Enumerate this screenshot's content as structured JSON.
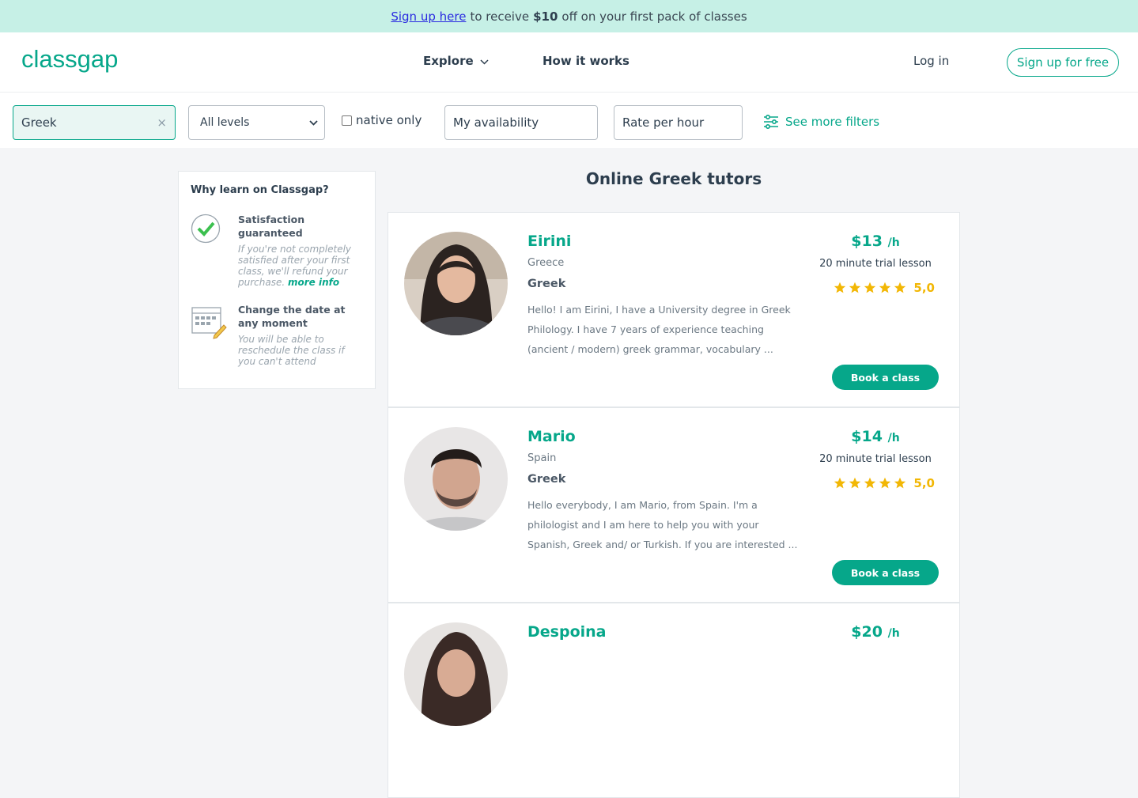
{
  "banner": {
    "link": "Sign up here",
    "text_before": "to receive",
    "amount": "$10",
    "text_after": "off on your first pack of classes"
  },
  "header": {
    "brand": "classgap",
    "nav_explore": "Explore",
    "nav_how": "How it works",
    "login": "Log in",
    "signup": "Sign up for free"
  },
  "filters": {
    "search_value": "Greek",
    "clear": "×",
    "level": "All levels",
    "native_label": "native only",
    "availability": "My availability",
    "rate": "Rate per hour",
    "more": "See more filters"
  },
  "sidebar": {
    "title": "Why learn on Classgap?",
    "items": [
      {
        "title": "Satisfaction guaranteed",
        "desc": "If you're not completely satisfied after your first class, we'll refund your purchase.",
        "link": "more info"
      },
      {
        "title": "Change the date at any moment",
        "desc": "You will be able to reschedule the class if you can't attend"
      }
    ]
  },
  "main": {
    "title": "Online Greek tutors",
    "book_label": "Book a class",
    "per_hour": "/h",
    "tutors": [
      {
        "name": "Eirini",
        "country": "Greece",
        "subject": "Greek",
        "desc": "Hello! I am Eirini, I have a University degree in Greek Philology. I have 7 years of experience teaching (ancient / modern) greek grammar, vocabulary ...",
        "price": "$13",
        "trial": "20 minute trial lesson",
        "rating": "5,0"
      },
      {
        "name": "Mario",
        "country": "Spain",
        "subject": "Greek",
        "desc": "Hello everybody, I am Mario, from Spain. I'm a philologist and I am here to help you with your Spanish, Greek and/ or Turkish. If you are interested ...",
        "price": "$14",
        "trial": "20 minute trial lesson",
        "rating": "5,0"
      },
      {
        "name": "Despoina",
        "country": "",
        "subject": "",
        "desc": "",
        "price": "$20",
        "trial": "",
        "rating": ""
      }
    ]
  },
  "colors": {
    "brand": "#06a78a",
    "banner_bg": "#c6f0e6",
    "star": "#f2b705",
    "text": "#2d3e4e"
  }
}
